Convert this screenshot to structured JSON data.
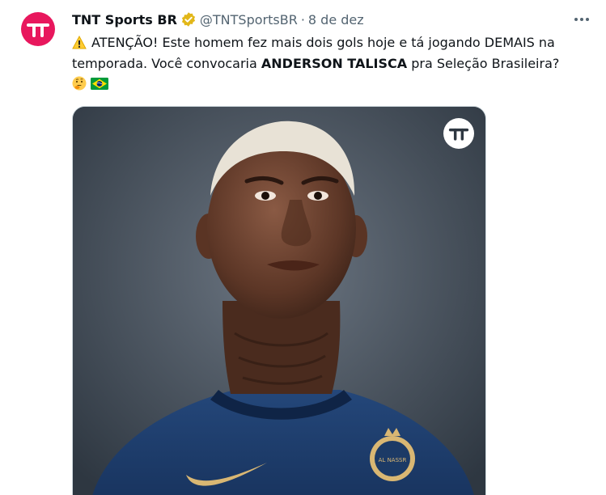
{
  "tweet": {
    "author": {
      "display_name": "TNT Sports BR",
      "handle": "@TNTSportsBR",
      "separator": "·",
      "date": "8 de dez",
      "verified_icon": "verified-badge-icon",
      "avatar_icon": "tnt-logo"
    },
    "text": {
      "warning_icon": "warning-icon",
      "part1": "ATENÇÃO! Este homem fez mais dois gols hoje e tá jogando DEMAIS na temporada. Você convocaria ",
      "bold_name": "ANDERSON TALISCA",
      "part2": " pra Seleção Brasileira?",
      "emoji_1": "thinking-face-icon",
      "emoji_2": "brazil-flag-icon"
    },
    "media": {
      "overlay_icon": "tnt-logo",
      "jersey_text": "AL NASSR"
    },
    "more_icon": "more-options-icon"
  },
  "colors": {
    "brand": "#e8175d",
    "text_primary": "#0f1419",
    "text_secondary": "#536471",
    "verified": "#e2b719",
    "jersey": "#1c3a66"
  }
}
